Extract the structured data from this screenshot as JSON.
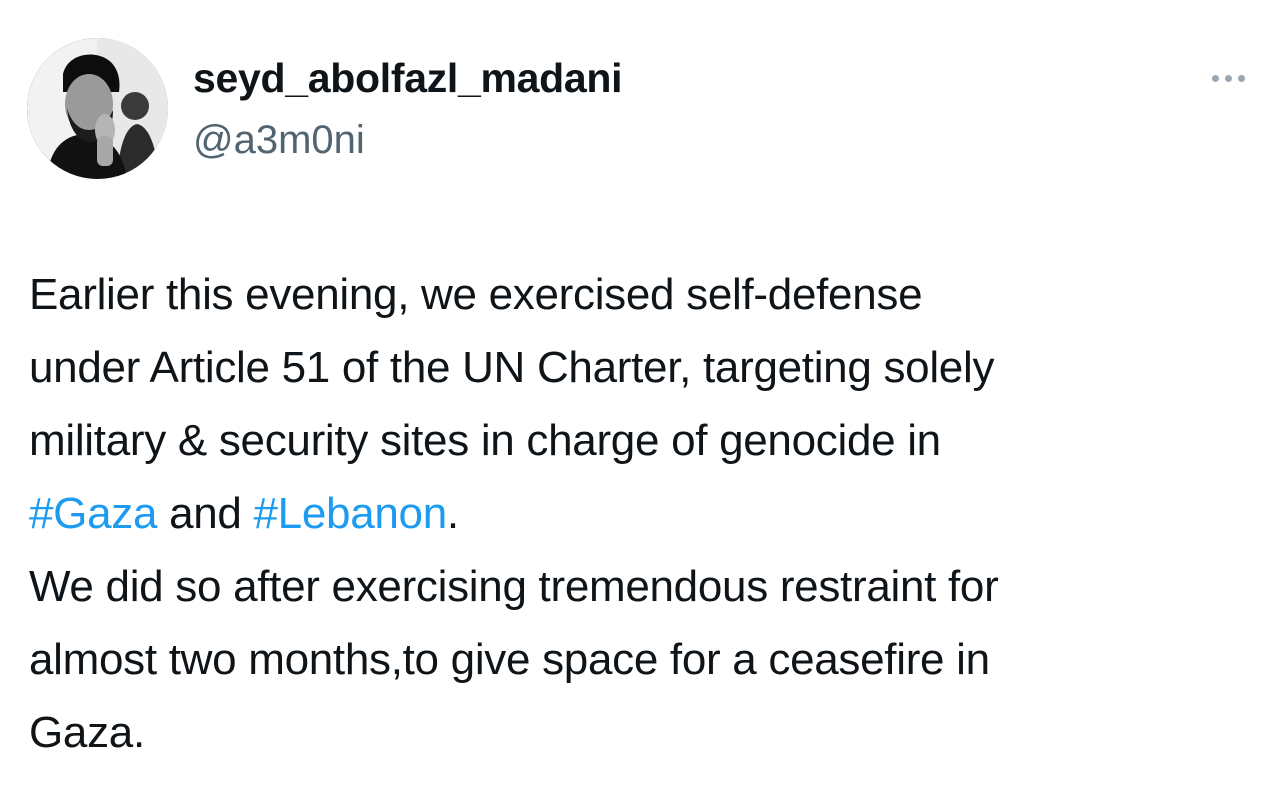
{
  "author": {
    "display_name": "seyd_abolfazl_madani",
    "handle": "@a3m0ni",
    "avatar_icon": "profile-photo"
  },
  "more_icon": "more-horizontal-icon",
  "colors": {
    "text": "#0f1419",
    "secondary": "#536471",
    "link": "#1d9bf0"
  },
  "tweet": {
    "line1": "Earlier this evening, we exercised self-defense",
    "line2": "under Article 51 of the UN Charter, targeting solely",
    "line3": "military & security sites in charge of genocide in",
    "hashtag1": "#Gaza",
    "and_text": " and ",
    "hashtag2": "#Lebanon",
    "period": ".",
    "line5": "We did so after exercising tremendous restraint for",
    "line6": "almost two months,to give space for a ceasefire in",
    "line7": "Gaza."
  }
}
